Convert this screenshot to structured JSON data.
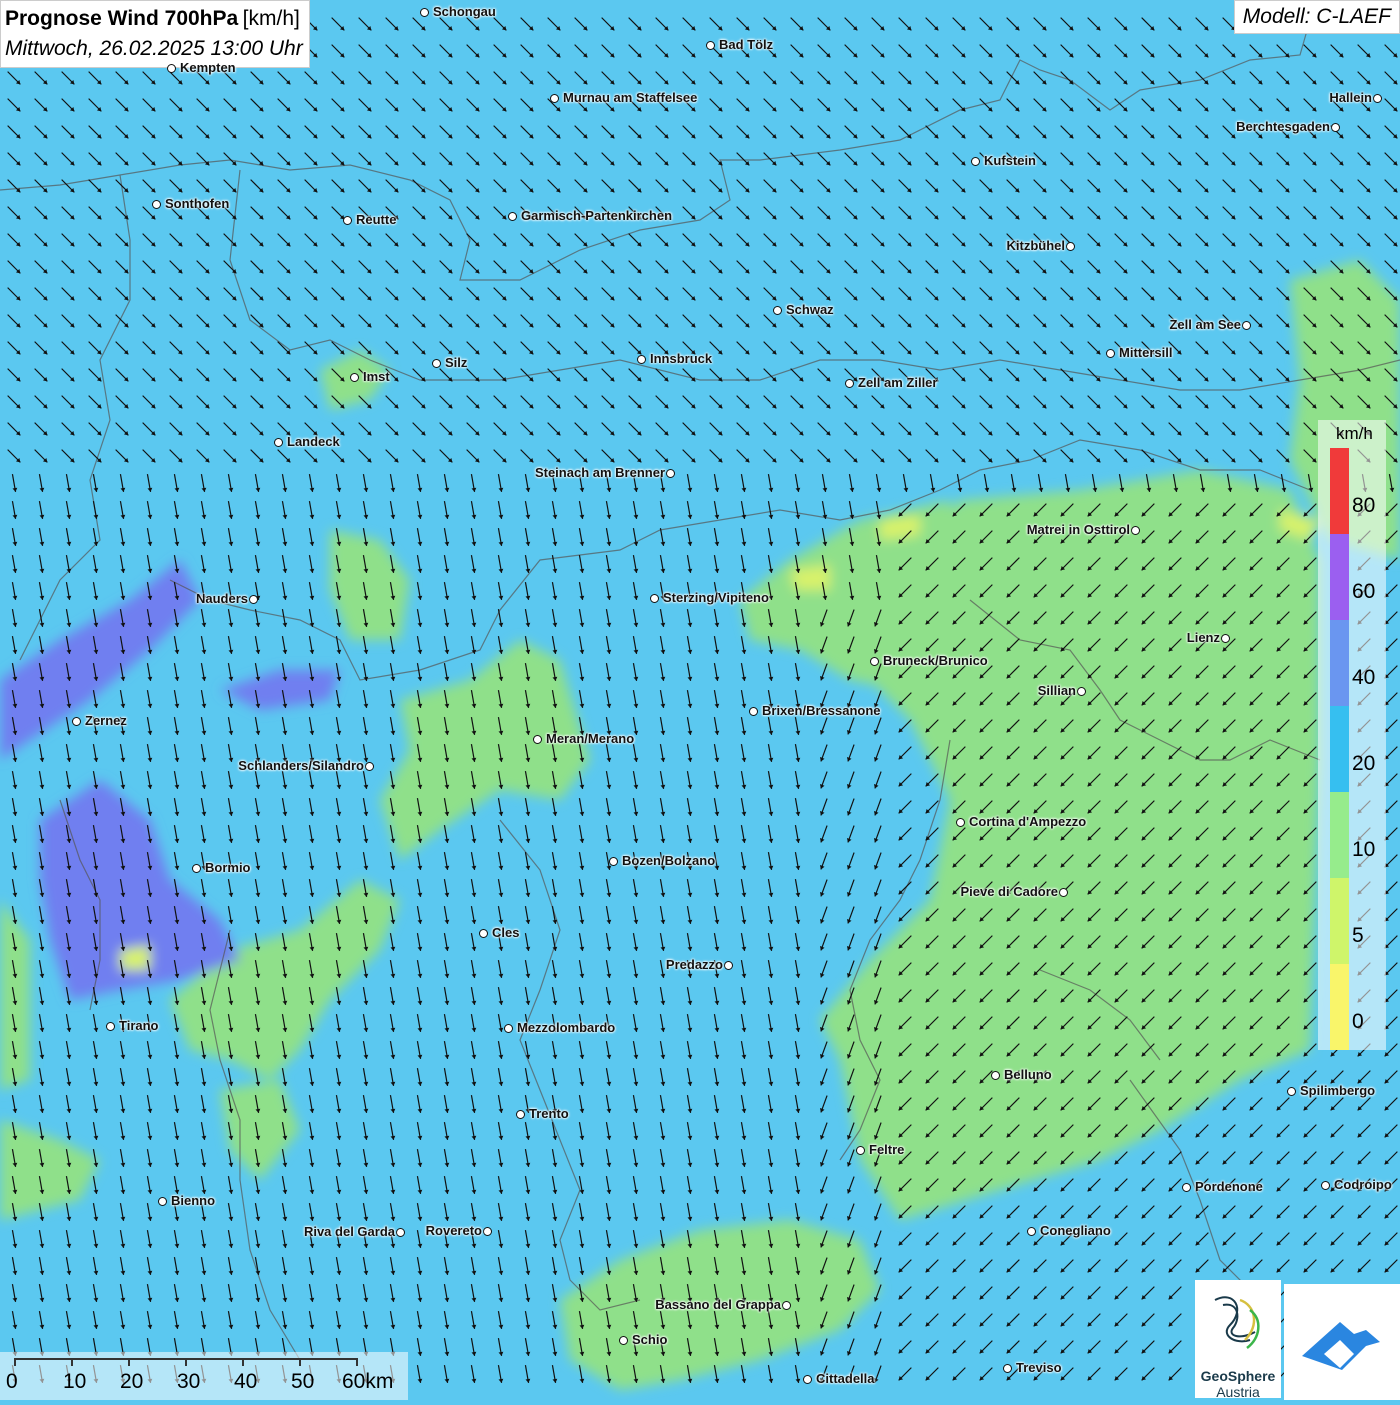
{
  "title": {
    "line1": "Prognose Wind 700hPa",
    "unit": "[km/h]",
    "line2": "Mittwoch, 26.02.2025 13:00 Uhr"
  },
  "model": "Modell: C-LAEF",
  "legend": {
    "unit": "km/h",
    "labels": [
      "80",
      "60",
      "40",
      "20",
      "10",
      "5",
      "0"
    ],
    "colors": [
      "#f03a3a",
      "#9b5ff0",
      "#6a96f0",
      "#36bff0",
      "#96ec8c",
      "#cff56a",
      "#f9f56a"
    ]
  },
  "scale": {
    "labels": [
      "0",
      "10",
      "20",
      "30",
      "40",
      "50",
      "60km"
    ]
  },
  "logo": {
    "name": "GeoSphere",
    "sub": "Austria"
  },
  "cities": [
    {
      "name": "Schongau"
    },
    {
      "name": "Bad Tölz"
    },
    {
      "name": "Kempten"
    },
    {
      "name": "Murnau am Staffelsee"
    },
    {
      "name": "Hallein"
    },
    {
      "name": "Berchtesgaden"
    },
    {
      "name": "Kufstein"
    },
    {
      "name": "Sonthofen"
    },
    {
      "name": "Reutte"
    },
    {
      "name": "Garmisch-Partenkirchen"
    },
    {
      "name": "Kitzbühel"
    },
    {
      "name": "Schwaz"
    },
    {
      "name": "Zell am See"
    },
    {
      "name": "Mittersill"
    },
    {
      "name": "Imst"
    },
    {
      "name": "Silz"
    },
    {
      "name": "Innsbruck"
    },
    {
      "name": "Zell am Ziller"
    },
    {
      "name": "Landeck"
    },
    {
      "name": "Steinach am Brenner"
    },
    {
      "name": "Matrei in Osttirol"
    },
    {
      "name": "Nauders"
    },
    {
      "name": "Sterzing/Vipiteno"
    },
    {
      "name": "Lienz"
    },
    {
      "name": "Bruneck/Brunico"
    },
    {
      "name": "Sillian"
    },
    {
      "name": "Zernez"
    },
    {
      "name": "Brixen/Bressanone"
    },
    {
      "name": "Meran/Merano"
    },
    {
      "name": "Schlanders/Silandro"
    },
    {
      "name": "Cortina d'Ampezzo"
    },
    {
      "name": "Bormio"
    },
    {
      "name": "Bozen/Bolzano"
    },
    {
      "name": "Pieve di Cadore"
    },
    {
      "name": "Cles"
    },
    {
      "name": "Predazzo"
    },
    {
      "name": "Tirano"
    },
    {
      "name": "Mezzolombardo"
    },
    {
      "name": "Belluno"
    },
    {
      "name": "Spilimbergo"
    },
    {
      "name": "Trento"
    },
    {
      "name": "Feltre"
    },
    {
      "name": "Pordenone"
    },
    {
      "name": "Codroipo"
    },
    {
      "name": "Bienno"
    },
    {
      "name": "Riva del Garda"
    },
    {
      "name": "Rovereto"
    },
    {
      "name": "Conegliano"
    },
    {
      "name": "Bassano del Grappa"
    },
    {
      "name": "Schio"
    },
    {
      "name": "Treviso"
    },
    {
      "name": "Cittadella"
    }
  ]
}
